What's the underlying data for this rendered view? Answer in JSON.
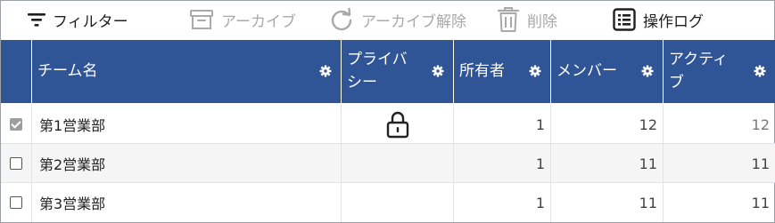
{
  "toolbar": {
    "filter": {
      "label": "フィルター",
      "icon": "filter-icon",
      "enabled": true
    },
    "archive": {
      "label": "アーカイブ",
      "icon": "archive-box-icon",
      "enabled": false
    },
    "unarchive": {
      "label": "アーカイブ解除",
      "icon": "refresh-icon",
      "enabled": false
    },
    "delete": {
      "label": "削除",
      "icon": "trash-icon",
      "enabled": false
    },
    "audit_log": {
      "label": "操作ログ",
      "icon": "list-icon",
      "enabled": true
    }
  },
  "table": {
    "header_color": "#2f5597",
    "columns": [
      {
        "key": "name",
        "label": "チーム名"
      },
      {
        "key": "privacy",
        "label_line1": "プライバ",
        "label_line2": "シー"
      },
      {
        "key": "owners",
        "label": "所有者"
      },
      {
        "key": "members",
        "label": "メンバー"
      },
      {
        "key": "active",
        "label_line1": "アクティ",
        "label_line2": "ブ"
      }
    ],
    "rows": [
      {
        "selected": true,
        "name": "第1営業部",
        "private": true,
        "owners": "1",
        "members": "12",
        "active": "12"
      },
      {
        "selected": false,
        "name": "第2営業部",
        "private": false,
        "owners": "1",
        "members": "11",
        "active": "11"
      },
      {
        "selected": false,
        "name": "第3営業部",
        "private": false,
        "owners": "1",
        "members": "11",
        "active": "11"
      }
    ]
  }
}
